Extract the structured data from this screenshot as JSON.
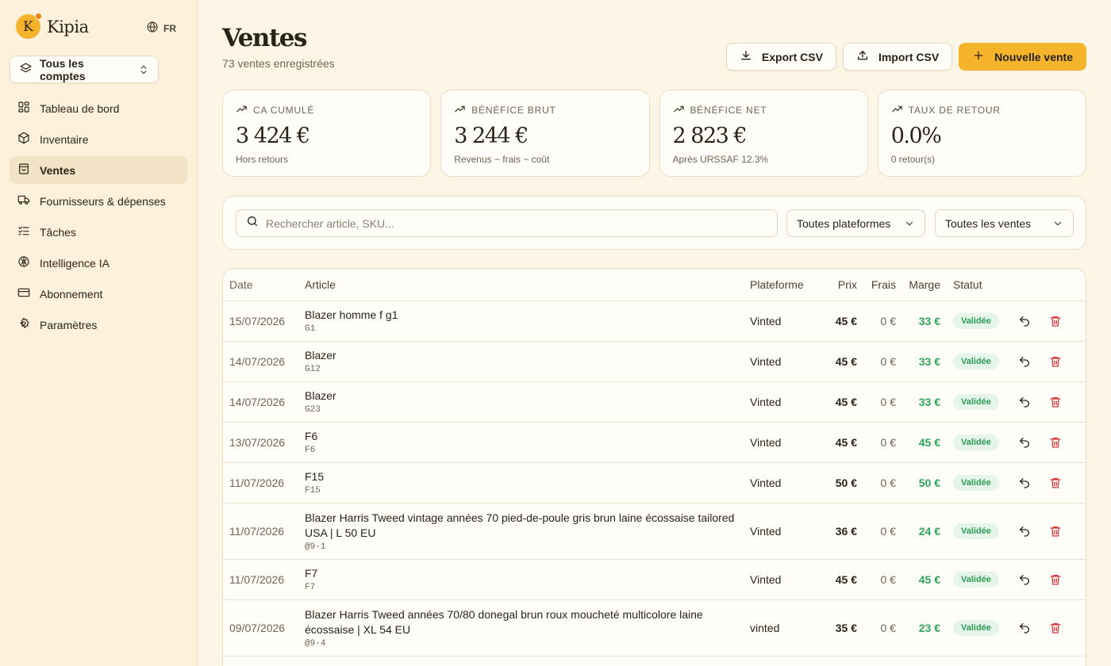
{
  "brand": {
    "logo_letter": "K",
    "name": "Kipia",
    "lang": "FR"
  },
  "account": {
    "label": "Tous les comptes"
  },
  "nav": [
    {
      "label": "Tableau de bord",
      "icon": "dashboard-icon"
    },
    {
      "label": "Inventaire",
      "icon": "box-icon"
    },
    {
      "label": "Ventes",
      "icon": "bag-icon",
      "active": true
    },
    {
      "label": "Fournisseurs & dépenses",
      "icon": "truck-icon"
    },
    {
      "label": "Tâches",
      "icon": "checklist-icon"
    },
    {
      "label": "Intelligence IA",
      "icon": "brain-icon"
    },
    {
      "label": "Abonnement",
      "icon": "card-icon"
    },
    {
      "label": "Paramètres",
      "icon": "gear-icon"
    }
  ],
  "header": {
    "title": "Ventes",
    "subtitle": "73 ventes enregistrées"
  },
  "actions": {
    "export": "Export CSV",
    "import": "Import CSV",
    "new": "Nouvelle vente"
  },
  "stats": [
    {
      "label": "CA cumulé",
      "value": "3 424 €",
      "note": "Hors retours"
    },
    {
      "label": "Bénéfice brut",
      "value": "3 244 €",
      "note": "Revenus − frais − coût"
    },
    {
      "label": "Bénéfice net",
      "value": "2 823 €",
      "note": "Après URSSAF 12.3%"
    },
    {
      "label": "Taux de retour",
      "value": "0.0%",
      "note": "0 retour(s)"
    }
  ],
  "filters": {
    "search_placeholder": "Rechercher article, SKU...",
    "platform": "Toutes plateformes",
    "sales": "Toutes les ventes"
  },
  "table": {
    "headers": {
      "date": "Date",
      "article": "Article",
      "platform": "Plateforme",
      "price": "Prix",
      "fees": "Frais",
      "margin": "Marge",
      "status": "Statut"
    },
    "rows": [
      {
        "date": "15/07/2026",
        "name": "Blazer homme f g1",
        "sku": "G1",
        "platform": "Vinted",
        "price": "45 €",
        "fees": "0 €",
        "margin": "33 €",
        "status": "Validée"
      },
      {
        "date": "14/07/2026",
        "name": "Blazer",
        "sku": "G12",
        "platform": "Vinted",
        "price": "45 €",
        "fees": "0 €",
        "margin": "33 €",
        "status": "Validée"
      },
      {
        "date": "14/07/2026",
        "name": "Blazer",
        "sku": "G23",
        "platform": "Vinted",
        "price": "45 €",
        "fees": "0 €",
        "margin": "33 €",
        "status": "Validée"
      },
      {
        "date": "13/07/2026",
        "name": "F6",
        "sku": "F6",
        "platform": "Vinted",
        "price": "45 €",
        "fees": "0 €",
        "margin": "45 €",
        "status": "Validée"
      },
      {
        "date": "11/07/2026",
        "name": "F15",
        "sku": "F15",
        "platform": "Vinted",
        "price": "50 €",
        "fees": "0 €",
        "margin": "50 €",
        "status": "Validée"
      },
      {
        "date": "11/07/2026",
        "name": "Blazer Harris Tweed vintage années 70 pied-de-poule gris brun laine écossaise tailored USA | L 50 EU",
        "sku": "@9-1",
        "platform": "Vinted",
        "price": "36 €",
        "fees": "0 €",
        "margin": "24 €",
        "status": "Validée"
      },
      {
        "date": "11/07/2026",
        "name": "F7",
        "sku": "F7",
        "platform": "Vinted",
        "price": "45 €",
        "fees": "0 €",
        "margin": "45 €",
        "status": "Validée"
      },
      {
        "date": "09/07/2026",
        "name": "Blazer Harris Tweed années 70/80 donegal brun roux moucheté multicolore laine écossaise | XL 54 EU",
        "sku": "@9-4",
        "platform": "vinted",
        "price": "35 €",
        "fees": "0 €",
        "margin": "23 €",
        "status": "Validée"
      }
    ]
  },
  "colors": {
    "accent": "#f6b42c",
    "margin_green": "#2ea55a",
    "delete_red": "#d63b3b"
  }
}
